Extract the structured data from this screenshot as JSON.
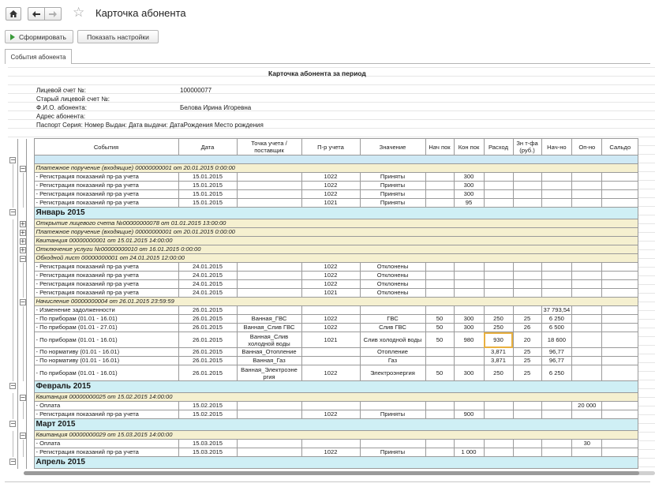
{
  "window": {
    "title": "Карточка абонента"
  },
  "toolbar": {
    "form_label": "Сформировать",
    "settings_label": "Показать настройки"
  },
  "tabs": [
    {
      "label": "События абонента"
    }
  ],
  "report": {
    "title": "Карточка абонента за период",
    "info": {
      "account_label": "Лицевой счет №:",
      "account_value": "100000077",
      "old_account_label": "Старый лицевой счет №:",
      "fio_label": "Ф.И.О. абонента:",
      "fio_value": "Белова Ирина Игоревна",
      "address_label": "Адрес абонента:",
      "passport_line": "Паспорт Серия:  Номер  Выдан:  Дата выдачи:  ДатаРождения  Место рождения"
    },
    "columns": [
      "События",
      "Дата",
      "Точка учета / поставщик",
      "П-р учета",
      "Значение",
      "Нач пок",
      "Кон пок",
      "Расход",
      "Зн т-фа (руб.)",
      "Нач-но",
      "Оп-но",
      "Сальдо"
    ],
    "rows": [
      {
        "type": "spacer"
      },
      {
        "type": "doc",
        "text": "Платежное поручение (входящие) 00000000001 от 20.01.2015 0:00:00"
      },
      {
        "type": "row",
        "cells": [
          "- Регистрация показаний пр-ра учета",
          "15.01.2015",
          "",
          "1022",
          "Приняты",
          "",
          "300",
          "",
          "",
          "",
          "",
          ""
        ]
      },
      {
        "type": "row",
        "cells": [
          "- Регистрация показаний пр-ра учета",
          "15.01.2015",
          "",
          "1022",
          "Приняты",
          "",
          "300",
          "",
          "",
          "",
          "",
          ""
        ]
      },
      {
        "type": "row",
        "cells": [
          "- Регистрация показаний пр-ра учета",
          "15.01.2015",
          "",
          "1022",
          "Приняты",
          "",
          "300",
          "",
          "",
          "",
          "",
          ""
        ]
      },
      {
        "type": "row",
        "cells": [
          "- Регистрация показаний пр-ра учета",
          "15.01.2015",
          "",
          "1021",
          "Приняты",
          "",
          "95",
          "",
          "",
          "",
          "",
          ""
        ]
      },
      {
        "type": "month",
        "text": "Январь 2015"
      },
      {
        "type": "doc",
        "collapsed": true,
        "text": "Открытие лицевого счета №00000000078 от 01.01.2015 13:00:00"
      },
      {
        "type": "doc",
        "collapsed": true,
        "text": "Платежное поручение (входящие) 00000000001 от 20.01.2015 0:00:00"
      },
      {
        "type": "doc",
        "collapsed": true,
        "text": "Квитанция 00000000001 от 15.01.2015 14:00:00"
      },
      {
        "type": "doc",
        "collapsed": true,
        "text": "Отключение услуги №00000000010 от 16.01.2015 0:00:00"
      },
      {
        "type": "doc",
        "text": "Обходной лист 00000000001 от 24.01.2015 12:00:00"
      },
      {
        "type": "row",
        "cells": [
          "- Регистрация показаний пр-ра учета",
          "24.01.2015",
          "",
          "1022",
          "Отклонены",
          "",
          "",
          "",
          "",
          "",
          "",
          ""
        ]
      },
      {
        "type": "row",
        "cells": [
          "- Регистрация показаний пр-ра учета",
          "24.01.2015",
          "",
          "1022",
          "Отклонены",
          "",
          "",
          "",
          "",
          "",
          "",
          ""
        ]
      },
      {
        "type": "row",
        "cells": [
          "- Регистрация показаний пр-ра учета",
          "24.01.2015",
          "",
          "1022",
          "Отклонены",
          "",
          "",
          "",
          "",
          "",
          "",
          ""
        ]
      },
      {
        "type": "row",
        "cells": [
          "- Регистрация показаний пр-ра учета",
          "24.01.2015",
          "",
          "1021",
          "Отклонены",
          "",
          "",
          "",
          "",
          "",
          "",
          ""
        ]
      },
      {
        "type": "doc",
        "text": "Начисление 00000000004 от 26.01.2015 23:59:59"
      },
      {
        "type": "row",
        "cells": [
          "- Изменение задолженности",
          "26.01.2015",
          "",
          "",
          "",
          "",
          "",
          "",
          "",
          "37 793,54",
          "",
          ""
        ]
      },
      {
        "type": "row",
        "cells": [
          "- По приборам (01.01 - 16.01)",
          "26.01.2015",
          "Ванная_ГВС",
          "1022",
          "ГВС",
          "50",
          "300",
          "250",
          "25",
          "6 250",
          "",
          ""
        ]
      },
      {
        "type": "row",
        "cells": [
          "- По приборам (01.01 - 27.01)",
          "26.01.2015",
          "Ванная_Слив ГВС",
          "1022",
          "Слив ГВС",
          "50",
          "300",
          "250",
          "26",
          "6 500",
          "",
          ""
        ]
      },
      {
        "type": "row",
        "tall": true,
        "highlight": 7,
        "cells": [
          "- По приборам (01.01 - 16.01)",
          "26.01.2015",
          "Ванная_Слив холодной воды",
          "1021",
          "Слив холодной воды",
          "50",
          "980",
          "930",
          "20",
          "18 600",
          "",
          ""
        ]
      },
      {
        "type": "row",
        "cells": [
          "- По нормативу (01.01 - 16.01)",
          "26.01.2015",
          "Ванная_Отопление",
          "",
          "Отопление",
          "",
          "",
          "3,871",
          "25",
          "96,77",
          "",
          ""
        ]
      },
      {
        "type": "row",
        "cells": [
          "- По нормативу (01.01 - 16.01)",
          "26.01.2015",
          "Ванная_Газ",
          "",
          "Газ",
          "",
          "",
          "3,871",
          "25",
          "96,77",
          "",
          ""
        ]
      },
      {
        "type": "row",
        "tall": true,
        "cells": [
          "- По приборам (01.01 - 16.01)",
          "26.01.2015",
          "Ванная_Электроэне ргия",
          "1022",
          "Электроэнергия",
          "50",
          "300",
          "250",
          "25",
          "6 250",
          "",
          ""
        ]
      },
      {
        "type": "month",
        "text": "Февраль 2015"
      },
      {
        "type": "doc",
        "text": "Квитанция 00000000025 от 15.02.2015 14:00:00"
      },
      {
        "type": "row",
        "cells": [
          "- Оплата",
          "15.02.2015",
          "",
          "",
          "",
          "",
          "",
          "",
          "",
          "",
          "20 000",
          ""
        ]
      },
      {
        "type": "row",
        "cells": [
          "- Регистрация показаний пр-ра учета",
          "15.02.2015",
          "",
          "1022",
          "Приняты",
          "",
          "900",
          "",
          "",
          "",
          "",
          ""
        ]
      },
      {
        "type": "month",
        "text": "Март 2015"
      },
      {
        "type": "doc",
        "text": "Квитанция 00000000029 от 15.03.2015 14:00:00"
      },
      {
        "type": "row",
        "cells": [
          "- Оплата",
          "15.03.2015",
          "",
          "",
          "",
          "",
          "",
          "",
          "",
          "",
          "30",
          ""
        ]
      },
      {
        "type": "row",
        "cells": [
          "- Регистрация показаний пр-ра учета",
          "15.03.2015",
          "",
          "1022",
          "Приняты",
          "",
          "1 000",
          "",
          "",
          "",
          "",
          ""
        ]
      },
      {
        "type": "month",
        "text": "Апрель 2015"
      }
    ]
  }
}
